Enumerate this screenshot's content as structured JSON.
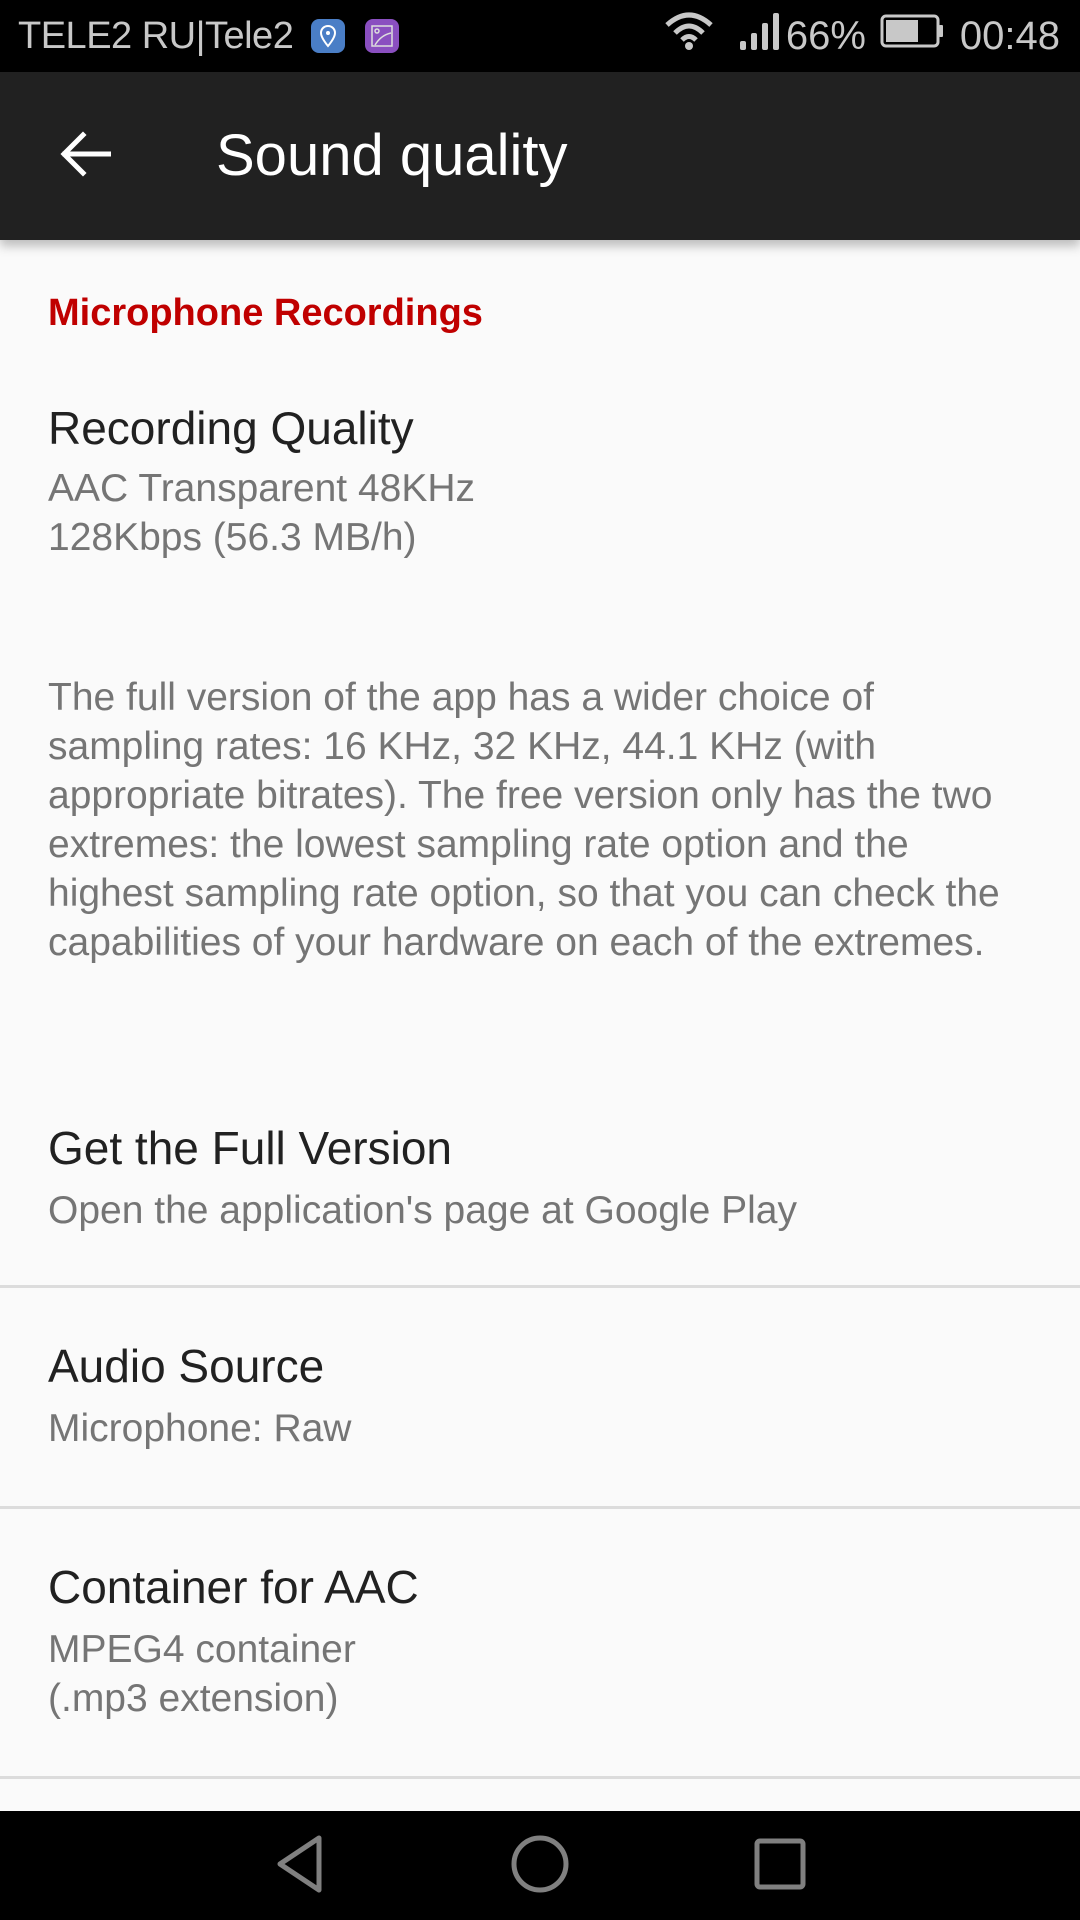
{
  "status_bar": {
    "carrier": "TELE2 RU|Tele2",
    "notification_icons": [
      "location-icon",
      "gallery-icon"
    ],
    "wifi_icon": "wifi-icon",
    "signal_icon": "signal-icon",
    "battery_percent": "66%",
    "battery_level": 0.66,
    "time": "00:48"
  },
  "toolbar": {
    "back_icon": "arrow-left-icon",
    "title": "Sound quality"
  },
  "section": {
    "header": "Microphone Recordings"
  },
  "preferences": [
    {
      "title": "Recording Quality",
      "summary": "AAC Transparent 48KHz\n128Kbps (56.3 MB/h)"
    },
    {
      "title": "Get the Full Version",
      "summary": "Open the application's page at Google Play"
    },
    {
      "title": "Audio Source",
      "summary": "Microphone: Raw"
    },
    {
      "title": "Container for AAC",
      "summary": "MPEG4 container\n(.mp3 extension)"
    }
  ],
  "info_paragraph": "The full version of the app has a wider choice of sampling rates: 16 KHz, 32 KHz, 44.1 KHz (with appropriate bitrates). The free version only has the two extremes: the lowest sampling rate option and the highest sampling rate option, so that you can check the capabilities of your hardware on each of the extremes.",
  "nav_bar": {
    "back": "nav-back-icon",
    "home": "nav-home-icon",
    "recents": "nav-recents-icon"
  }
}
